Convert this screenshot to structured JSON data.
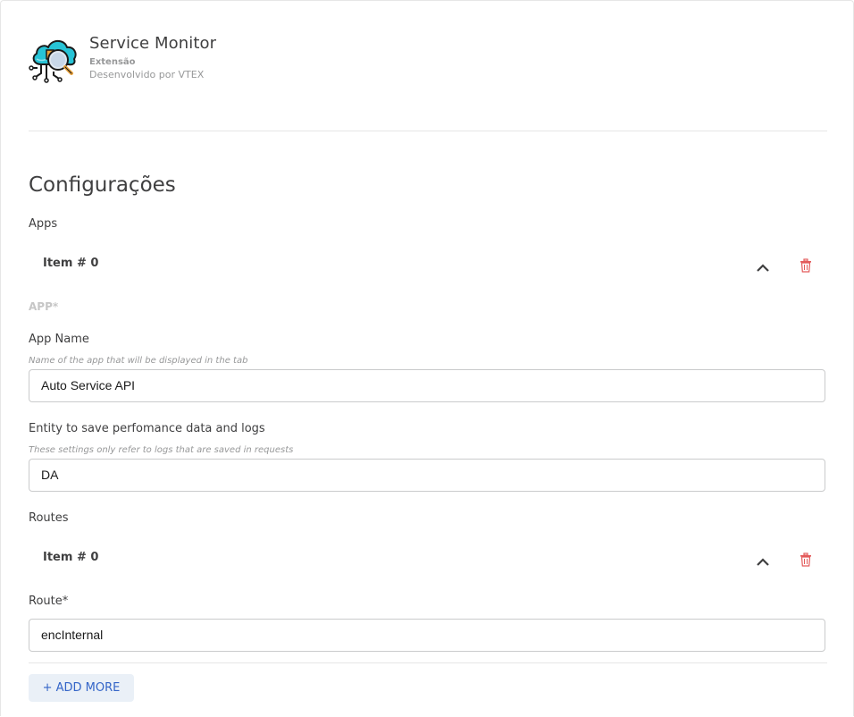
{
  "header": {
    "title": "Service Monitor",
    "type": "Extensão",
    "developer": "Desenvolvido por VTEX"
  },
  "settings": {
    "section_title": "Configurações",
    "apps_label": "Apps",
    "app_item_title": "Item # 0",
    "app_group_label": "APP*",
    "app_name": {
      "label": "App Name",
      "help": "Name of the app that will be displayed in the tab",
      "value": "Auto Service API"
    },
    "entity": {
      "label": "Entity to save perfomance data and logs",
      "help": "These settings only refer to logs that are saved in requests",
      "value": "DA"
    },
    "routes_label": "Routes",
    "route_item_title": "Item # 0",
    "route": {
      "label": "Route*",
      "value": "encInternal"
    },
    "add_more_label": "+ ADD MORE"
  },
  "icons": {
    "app_icon": "cloud-magnifier-icon",
    "collapse": "chevron-up-icon",
    "delete": "trash-icon"
  },
  "colors": {
    "accent": "#3465c8",
    "danger": "#e35a5a",
    "icon_cyan": "#27c3d6"
  }
}
